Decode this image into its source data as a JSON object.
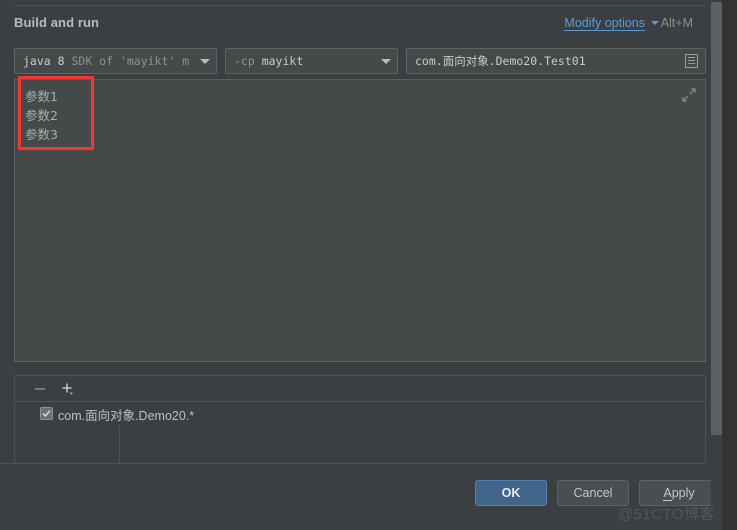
{
  "header": {
    "title": "Build and run",
    "modify_options_label": "Modify options",
    "modify_options_accel_letter": "M",
    "modify_options_rest": "odify options",
    "shortcut": "Alt+M",
    "chevron_icon": "chevron-down-icon",
    "link_color": "#5b9bd5"
  },
  "fields": {
    "sdk_combo": {
      "prefix": "java 8 ",
      "suffix": "SDK of 'mayikt' m",
      "value": "java 8 SDK of 'mayikt' m",
      "arrow_icon": "chevron-down-icon"
    },
    "cp_combo": {
      "prefix": "-cp ",
      "suffix": "mayikt",
      "value": "-cp mayikt",
      "arrow_icon": "chevron-down-icon"
    },
    "main_class": {
      "value": "com.面向对象.Demo20.Test01",
      "icon": "class-browse-icon"
    }
  },
  "program_arguments": {
    "lines": [
      "参数1",
      "参数2",
      "参数3"
    ],
    "expand_icon": "expand-arrows-icon",
    "highlight_color": "#f4372f"
  },
  "before_launch": {
    "toolbar": {
      "remove_icon": "minus-icon",
      "add_icon": "plus-dropdown-icon"
    },
    "items": [
      {
        "label": "com.面向对象.Demo20.*",
        "checked": true,
        "checkbox_icon": "checkbox-checked-icon"
      }
    ]
  },
  "footer": {
    "ok_label": "OK",
    "cancel_label": "Cancel",
    "apply_label": "Apply",
    "apply_accel_letter": "A",
    "apply_rest": "pply",
    "ok_color": "#41658a"
  },
  "scrollbar": {
    "thumb_name": "vertical-scrollbar-thumb"
  },
  "watermark": {
    "text": "@51CTO博客"
  }
}
